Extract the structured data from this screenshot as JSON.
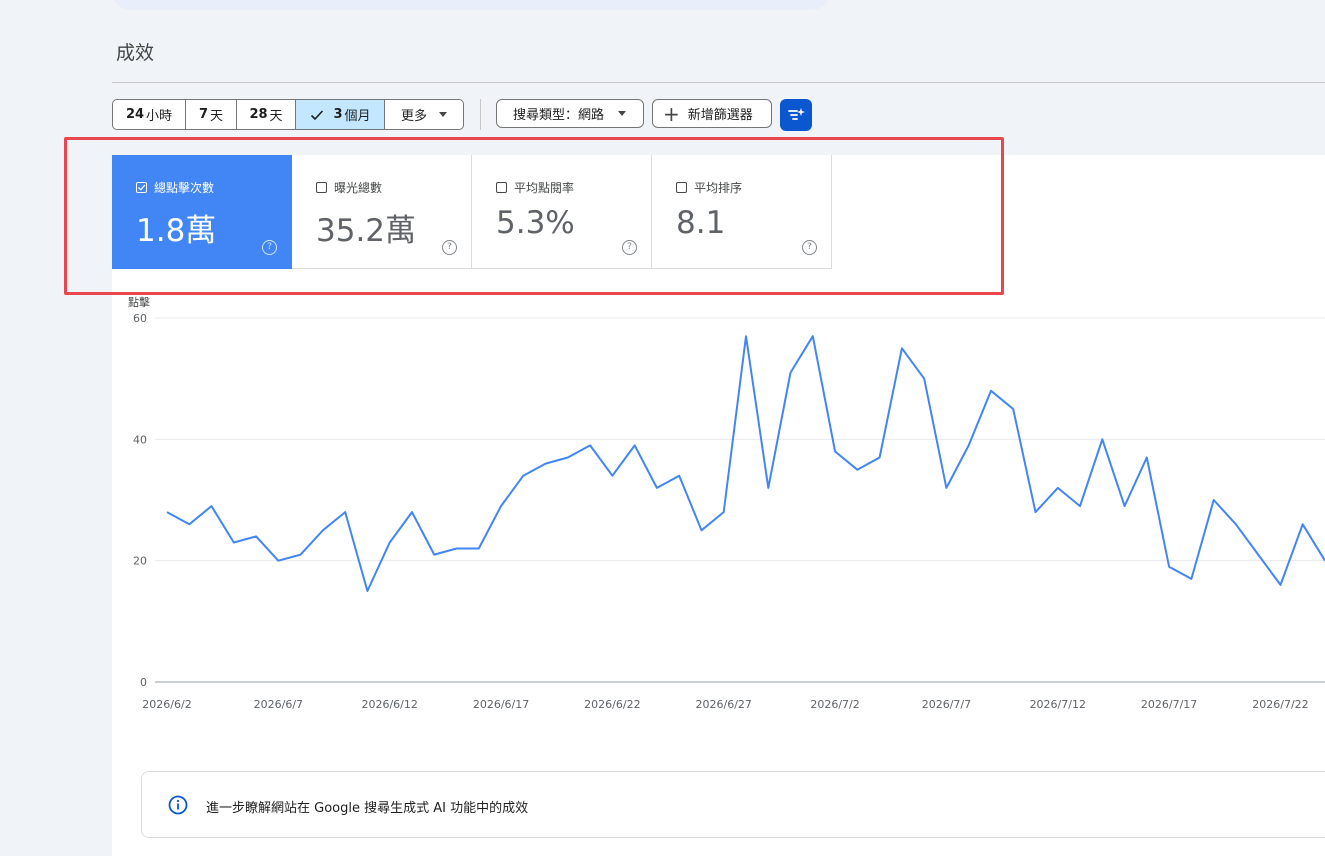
{
  "page": {
    "title": "成效"
  },
  "toolbar": {
    "date_ranges": [
      {
        "num": "24",
        "unit": "小時",
        "active": false
      },
      {
        "num": "7",
        "unit": "天",
        "active": false
      },
      {
        "num": "28",
        "unit": "天",
        "active": false
      },
      {
        "num": "3",
        "unit": "個月",
        "active": true
      }
    ],
    "more_label": "更多",
    "search_type_label": "搜尋類型：網路",
    "add_filter_label": "新增篩選器",
    "ai_filter_icon": "ai-filter-icon"
  },
  "metrics": [
    {
      "label": "總點擊次數",
      "value": "1.8萬",
      "checked": true
    },
    {
      "label": "曝光總數",
      "value": "35.2萬",
      "checked": false
    },
    {
      "label": "平均點閱率",
      "value": "5.3%",
      "checked": false
    },
    {
      "label": "平均排序",
      "value": "8.1",
      "checked": false
    }
  ],
  "chart_data": {
    "type": "line",
    "ylabel": "點擊",
    "ylim": [
      0,
      60
    ],
    "yticks": [
      0,
      20,
      40,
      60
    ],
    "x_start": "2026/6/2",
    "xticks": [
      "2026/6/2",
      "2026/6/7",
      "2026/6/12",
      "2026/6/17",
      "2026/6/22",
      "2026/6/27",
      "2026/7/2",
      "2026/7/7",
      "2026/7/12",
      "2026/7/17",
      "2026/7/22"
    ],
    "series": [
      {
        "color": "#4285f4",
        "values": [
          28,
          26,
          29,
          23,
          24,
          20,
          21,
          25,
          28,
          15,
          23,
          28,
          21,
          22,
          22,
          29,
          34,
          36,
          37,
          39,
          34,
          39,
          32,
          34,
          25,
          28,
          57,
          32,
          51,
          57,
          38,
          35,
          37,
          55,
          50,
          32,
          39,
          48,
          45,
          28,
          32,
          29,
          40,
          29,
          37,
          19,
          17,
          30,
          26,
          21,
          16,
          26,
          20
        ]
      }
    ],
    "grid": true
  },
  "info": {
    "text": "進一步瞭解網站在 Google 搜尋生成式 AI 功能中的成效"
  }
}
